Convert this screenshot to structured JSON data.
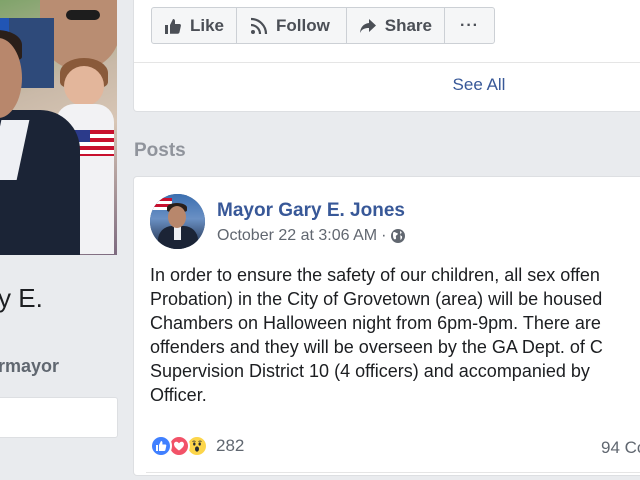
{
  "profile": {
    "name_fragment": "y E.",
    "handle_fragment": "rmayor"
  },
  "actions": {
    "like_label": "Like",
    "follow_label": "Follow",
    "share_label": "Share",
    "more_label": "···"
  },
  "see_all_label": "See All",
  "posts_heading": "Posts",
  "post": {
    "author": "Mayor Gary E. Jones",
    "timestamp": "October 22 at 3:06 AM",
    "meta_separator": "·",
    "privacy_icon": "globe-icon",
    "body_lines": [
      "In order to ensure the safety of our children, all sex offen",
      "Probation) in the City of Grovetown (area) will be housed",
      "Chambers on Halloween night from 6pm-9pm. There are",
      "offenders and they will be overseen by the GA Dept. of C",
      "Supervision District 10 (4 officers) and accompanied by",
      "Officer."
    ],
    "reaction_icons": [
      "like-reaction-icon",
      "love-reaction-icon",
      "wow-reaction-icon"
    ],
    "reaction_count": "282",
    "comments_fragment": "94 Co"
  },
  "colors": {
    "link_blue": "#385898",
    "background": "#e9ebee",
    "muted_text": "#606770",
    "like_blue": "#4080ff",
    "love_red": "#f25268",
    "wow_yellow": "#fcd54a"
  }
}
